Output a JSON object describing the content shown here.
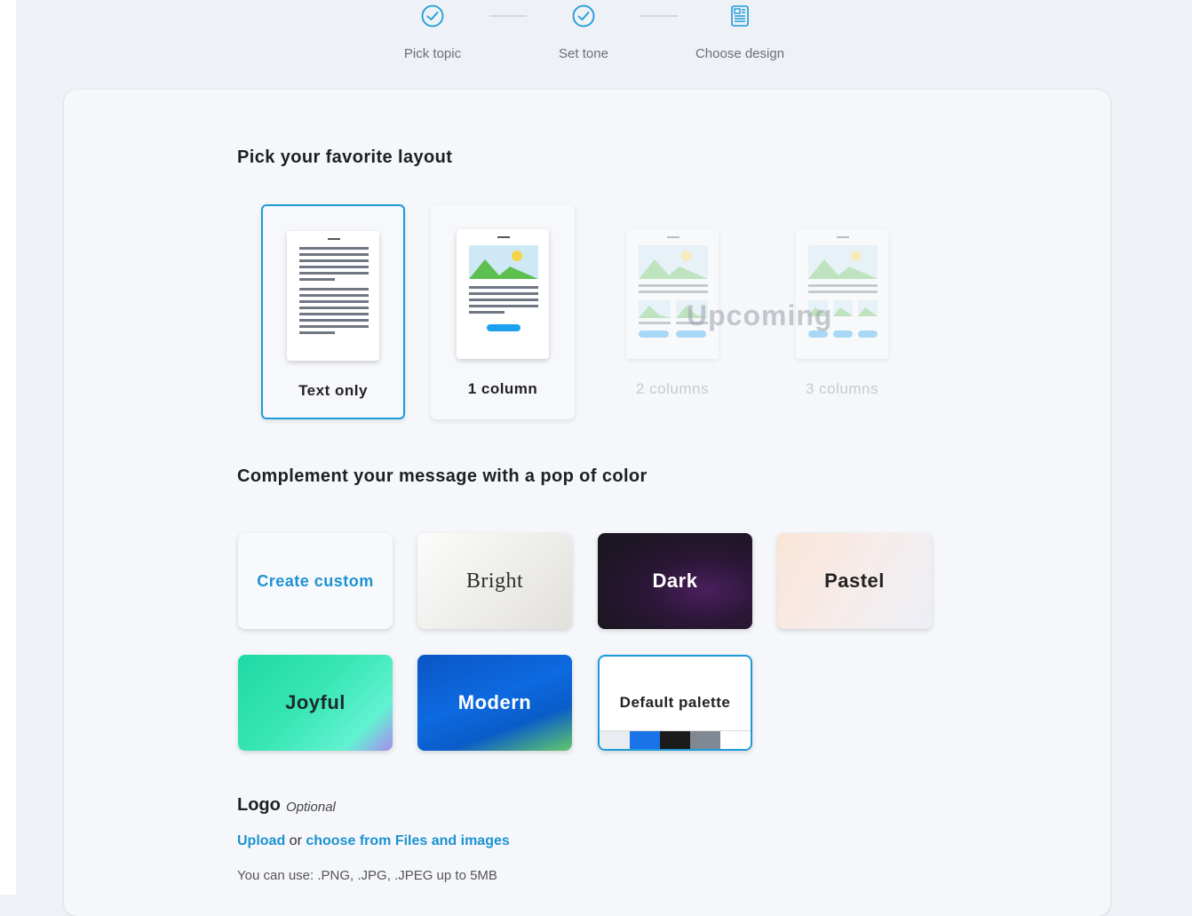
{
  "stepper": {
    "steps": [
      {
        "label": "Pick topic",
        "icon": "check-circle-icon"
      },
      {
        "label": "Set tone",
        "icon": "check-circle-icon"
      },
      {
        "label": "Choose design",
        "icon": "design-doc-icon"
      }
    ]
  },
  "layout_section": {
    "title": "Pick your favorite layout",
    "options": [
      {
        "label": "Text only",
        "selected": true
      },
      {
        "label": "1 column"
      },
      {
        "label": "2 columns",
        "disabled": true
      },
      {
        "label": "3 columns",
        "disabled": true
      }
    ],
    "upcoming_label": "Upcoming"
  },
  "color_section": {
    "title": "Complement your message with a pop of color",
    "options": [
      {
        "label": "Create custom"
      },
      {
        "label": "Bright"
      },
      {
        "label": "Dark"
      },
      {
        "label": "Pastel"
      },
      {
        "label": "Joyful"
      },
      {
        "label": "Modern"
      },
      {
        "label": "Default palette",
        "selected": true,
        "swatches": [
          "#e9ecf0",
          "#1a73e8",
          "#1b1b1b",
          "#7f8893",
          "#ffffff"
        ]
      }
    ]
  },
  "logo_section": {
    "title": "Logo",
    "optional_label": "Optional",
    "upload_link": "Upload",
    "or_text": "or",
    "choose_link": "choose from Files and images",
    "hint": "You can use: .PNG, .JPG, .JPEG up to 5MB"
  },
  "colors": {
    "accent": "#1c9bdb",
    "link": "#1c92d2"
  }
}
